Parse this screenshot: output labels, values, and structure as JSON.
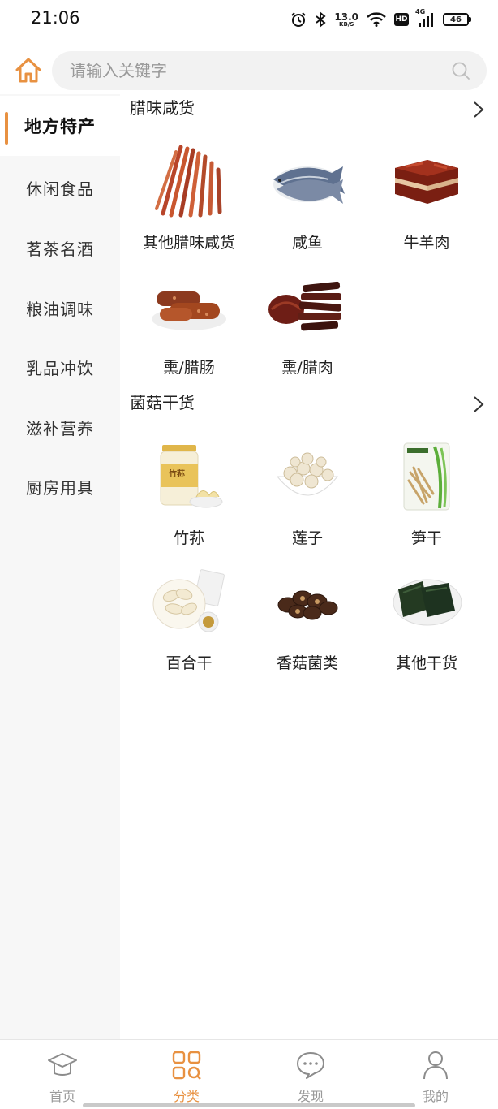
{
  "status_bar": {
    "time": "21:06",
    "net_speed_value": "13.0",
    "net_speed_unit": "KB/S",
    "hd_label": "HD",
    "network_label": "4G",
    "battery_level": "46",
    "icons": [
      "alarm-icon",
      "bluetooth-icon",
      "wifi-icon",
      "hd-icon",
      "signal-icon",
      "battery-icon"
    ]
  },
  "header": {
    "search_placeholder": "请输入关键字"
  },
  "colors": {
    "accent": "#e89141",
    "sidebar_bg": "#f7f7f7",
    "search_bg": "#f2f2f2"
  },
  "sidebar": {
    "items": [
      {
        "label": "地方特产",
        "active": true
      },
      {
        "label": "休闲食品",
        "active": false
      },
      {
        "label": "茗茶名酒",
        "active": false
      },
      {
        "label": "粮油调味",
        "active": false
      },
      {
        "label": "乳品冲饮",
        "active": false
      },
      {
        "label": "滋补营养",
        "active": false
      },
      {
        "label": "厨房用具",
        "active": false
      }
    ]
  },
  "sections": [
    {
      "title": "腊味咸货",
      "items": [
        {
          "label": "其他腊味咸货",
          "image": "jerky-strips-image"
        },
        {
          "label": "咸鱼",
          "image": "salted-fish-image"
        },
        {
          "label": "牛羊肉",
          "image": "braised-meat-image"
        },
        {
          "label": "熏/腊肠",
          "image": "sausage-image"
        },
        {
          "label": "熏/腊肉",
          "image": "cured-meat-image"
        }
      ]
    },
    {
      "title": "菌菇干货",
      "items": [
        {
          "label": "竹荪",
          "image": "bamboo-fungus-jar-image",
          "jar_text": "竹荪"
        },
        {
          "label": "莲子",
          "image": "lotus-seed-bowl-image"
        },
        {
          "label": "笋干",
          "image": "dried-bamboo-shoot-image"
        },
        {
          "label": "百合干",
          "image": "dried-lily-image"
        },
        {
          "label": "香菇菌类",
          "image": "mushroom-image"
        },
        {
          "label": "其他干货",
          "image": "seaweed-image"
        }
      ]
    }
  ],
  "bottom_nav": {
    "items": [
      {
        "label": "首页",
        "icon": "home-hat-icon",
        "active": false
      },
      {
        "label": "分类",
        "icon": "category-grid-icon",
        "active": true
      },
      {
        "label": "发现",
        "icon": "chat-bubble-icon",
        "active": false
      },
      {
        "label": "我的",
        "icon": "user-profile-icon",
        "active": false
      }
    ]
  }
}
